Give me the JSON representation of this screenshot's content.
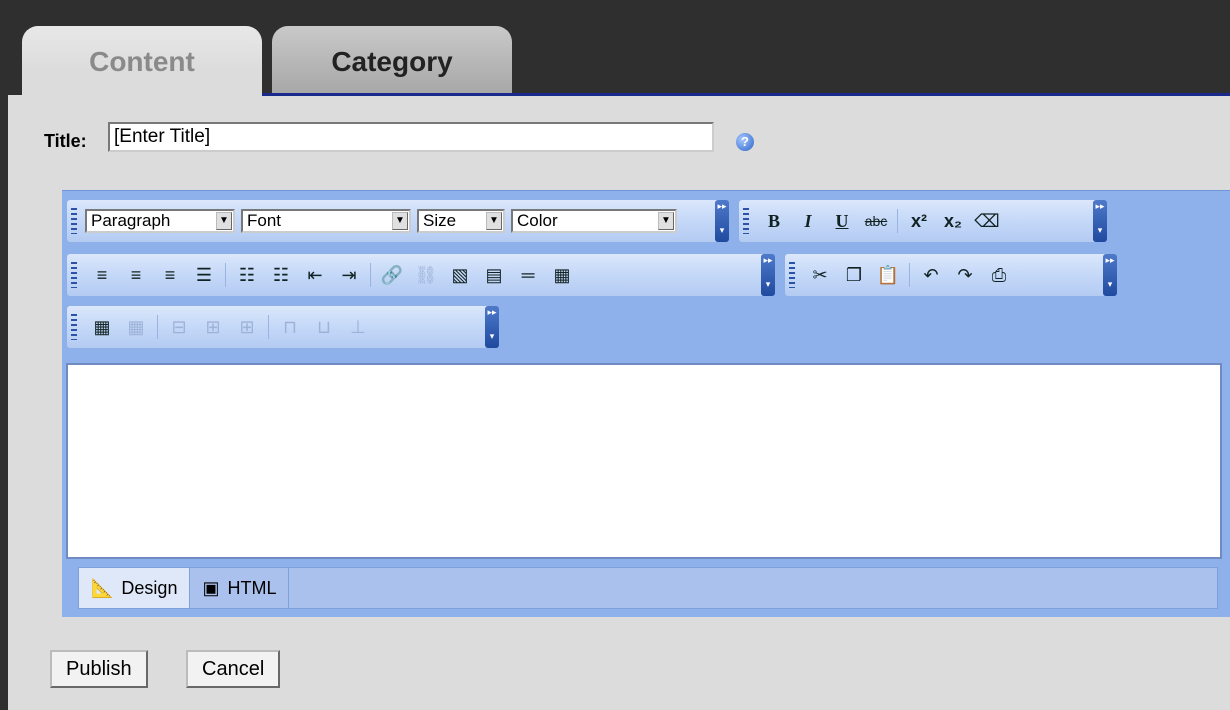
{
  "tabs": [
    {
      "label": "Content"
    },
    {
      "label": "Category"
    }
  ],
  "form": {
    "title_label": "Title:",
    "title_value": "[Enter Title]",
    "help_icon": "help-icon"
  },
  "toolbar1": {
    "paragraph": "Paragraph",
    "font": "Font",
    "size": "Size",
    "color": "Color",
    "bold": "B",
    "italic": "I",
    "underline": "U",
    "strike": "abc",
    "superscript": "x²",
    "subscript": "x₂"
  },
  "mode_tabs": {
    "design": "Design",
    "html": "HTML"
  },
  "buttons": {
    "publish": "Publish",
    "cancel": "Cancel"
  }
}
